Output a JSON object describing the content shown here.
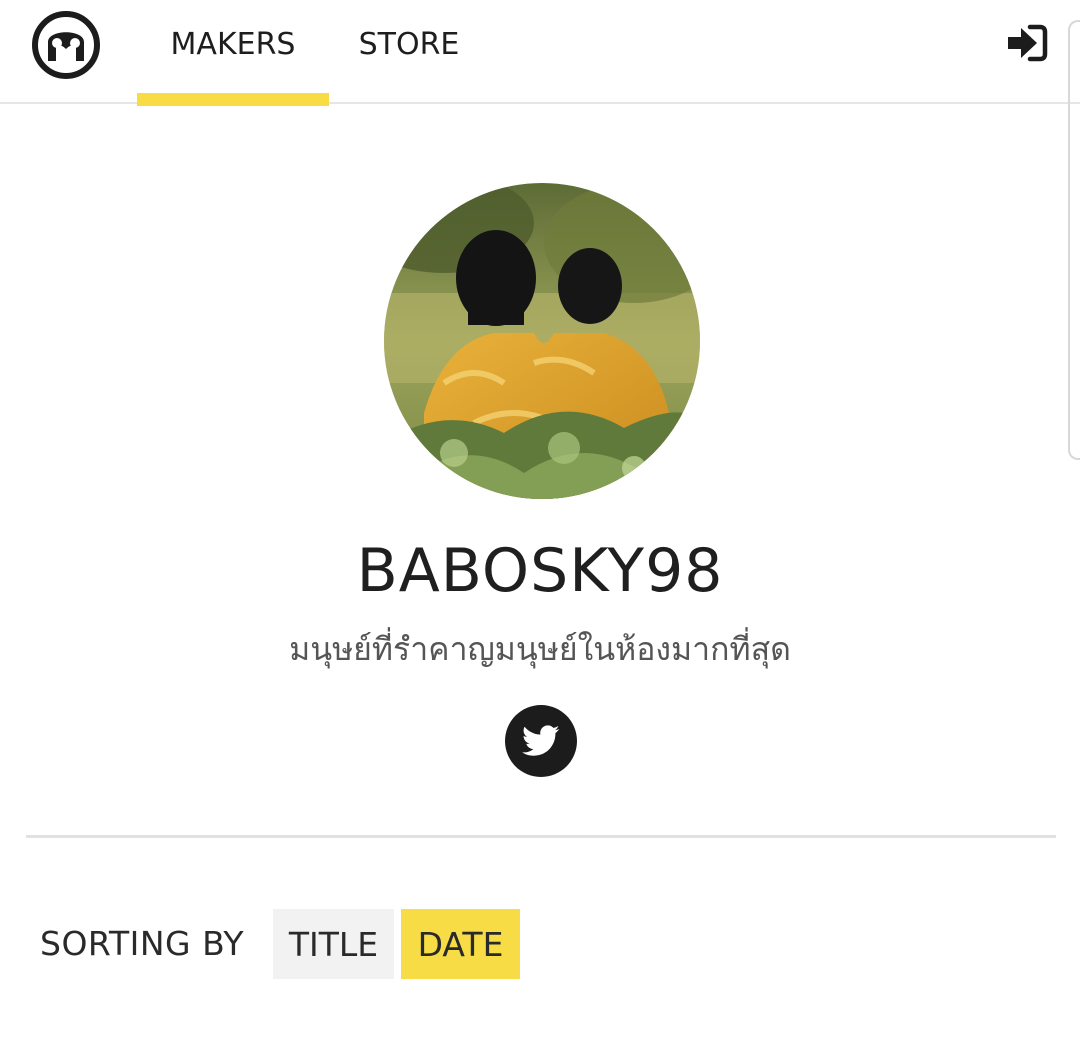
{
  "nav": {
    "logo_icon": "face-logo-icon",
    "tabs": [
      {
        "label": "MAKERS",
        "active": true
      },
      {
        "label": "STORE",
        "active": false
      }
    ],
    "login_icon": "sign-in-icon"
  },
  "profile": {
    "avatar_icon": "profile-photo",
    "username": "BABOSKY98",
    "bio": "มนุษย์ที่รำคาญมนุษย์ในห้องมากที่สุด",
    "social_icon": "twitter-icon"
  },
  "sorting": {
    "label": "SORTING BY",
    "options": [
      {
        "label": "TITLE",
        "active": false
      },
      {
        "label": "DATE",
        "active": true
      }
    ]
  },
  "colors": {
    "accent": "#f7dc45",
    "text": "#222222",
    "divider": "#e1e1e1"
  }
}
